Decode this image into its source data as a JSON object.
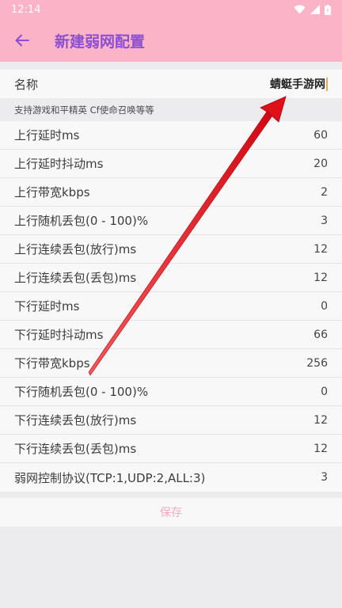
{
  "status_bar": {
    "time": "12:14"
  },
  "app_bar": {
    "title": "新建弱网配置"
  },
  "name_field": {
    "label": "名称",
    "value": "蜻蜓手游网"
  },
  "hint": "支持游戏和平精英 Cf使命召唤等等",
  "settings": [
    {
      "label": "上行延时ms",
      "value": "60"
    },
    {
      "label": "上行延时抖动ms",
      "value": "20"
    },
    {
      "label": "上行带宽kbps",
      "value": "2"
    },
    {
      "label": "上行随机丢包(0 - 100)%",
      "value": "3"
    },
    {
      "label": "上行连续丢包(放行)ms",
      "value": "12"
    },
    {
      "label": "上行连续丢包(丢包)ms",
      "value": "12"
    },
    {
      "label": "下行延时ms",
      "value": "0"
    },
    {
      "label": "下行延时抖动ms",
      "value": "66"
    },
    {
      "label": "下行带宽kbps",
      "value": "256"
    },
    {
      "label": "下行随机丢包(0 - 100)%",
      "value": "0"
    },
    {
      "label": "下行连续丢包(放行)ms",
      "value": "12"
    },
    {
      "label": "下行连续丢包(丢包)ms",
      "value": "12"
    },
    {
      "label": "弱网控制协议(TCP:1,UDP:2,ALL:3)",
      "value": "3"
    }
  ],
  "save_label": "保存",
  "colors": {
    "header": "#fbb3c8",
    "title": "#8c4fd1",
    "save": "#f6a9c3",
    "arrow": "#e0101a"
  },
  "icons": {
    "back": "arrow-left-icon",
    "wifi": "wifi-icon",
    "signal": "signal-icon",
    "battery": "battery-icon"
  }
}
